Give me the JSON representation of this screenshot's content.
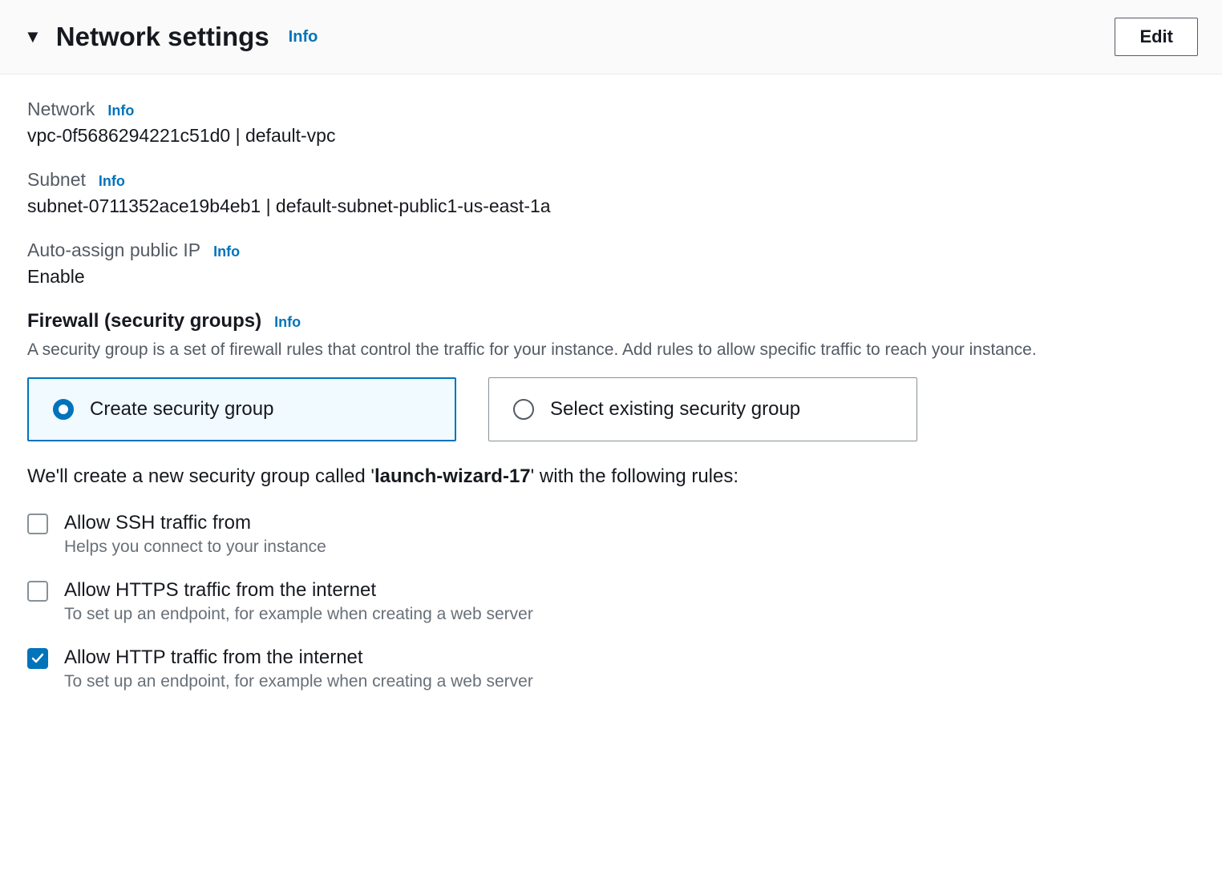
{
  "header": {
    "title": "Network settings",
    "info_label": "Info",
    "edit_label": "Edit"
  },
  "network": {
    "label": "Network",
    "info_label": "Info",
    "value": "vpc-0f5686294221c51d0 | default-vpc"
  },
  "subnet": {
    "label": "Subnet",
    "info_label": "Info",
    "value": "subnet-0711352ace19b4eb1 | default-subnet-public1-us-east-1a"
  },
  "auto_ip": {
    "label": "Auto-assign public IP",
    "info_label": "Info",
    "value": "Enable"
  },
  "firewall": {
    "heading": "Firewall (security groups)",
    "info_label": "Info",
    "description": "A security group is a set of firewall rules that control the traffic for your instance. Add rules to allow specific traffic to reach your instance.",
    "options": {
      "create": "Create security group",
      "select": "Select existing security group"
    },
    "create_text_prefix": "We'll create a new security group called '",
    "create_sg_name": "launch-wizard-17",
    "create_text_suffix": "' with the following rules:"
  },
  "rules": {
    "ssh": {
      "label": "Allow SSH traffic from",
      "help": "Helps you connect to your instance",
      "checked": false
    },
    "https": {
      "label": "Allow HTTPS traffic from the internet",
      "help": "To set up an endpoint, for example when creating a web server",
      "checked": false
    },
    "http": {
      "label": "Allow HTTP traffic from the internet",
      "help": "To set up an endpoint, for example when creating a web server",
      "checked": true
    }
  }
}
